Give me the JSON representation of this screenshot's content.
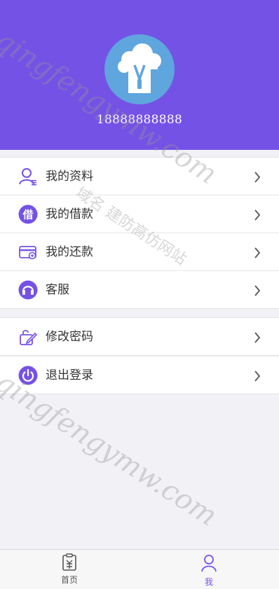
{
  "profile": {
    "phone": "18888888888",
    "avatar_icon": "cloud-zip-avatar-icon"
  },
  "menu_group_1": [
    {
      "label": "我的资料",
      "icon": "user-profile-icon"
    },
    {
      "label": "我的借款",
      "icon": "borrow-icon"
    },
    {
      "label": "我的还款",
      "icon": "repay-card-icon"
    },
    {
      "label": "客服",
      "icon": "customer-service-icon"
    }
  ],
  "menu_group_2": [
    {
      "label": "修改密码",
      "icon": "edit-password-icon"
    },
    {
      "label": "退出登录",
      "icon": "power-icon"
    }
  ],
  "borrow_glyph": "借",
  "tabbar": {
    "home": {
      "label": "首页",
      "icon": "home-doc-icon"
    },
    "me": {
      "label": "我",
      "icon": "user-icon",
      "active": true
    }
  },
  "watermarks": {
    "top_latin": "qingfengymw.com",
    "top_chinese": "域名 建防高仿网站",
    "bottom_latin": "qingfengymw.com"
  },
  "colors": {
    "header": "#7552e6",
    "accent": "#7552e6",
    "avatar_bg": "#5fa5de",
    "page_bg": "#f2f1f6"
  }
}
